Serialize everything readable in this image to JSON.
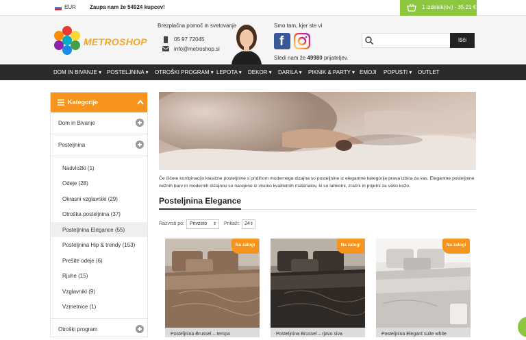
{
  "topbar": {
    "currency": "EUR",
    "promo": "Zaupa nam že 54924 kupcev!",
    "cart": "1 izdelek(ov) - 35.21 €"
  },
  "header": {
    "logo_text": "METROSHOP",
    "help_title": "Brezplačna pomoč in svetovanje",
    "phone": "05 97 72045",
    "email": "info@metroshop.si",
    "social_title": "Smo tam, kjer ste vi",
    "fans_prefix": "Sledi nam že",
    "fans_count": "49980",
    "fans_suffix": "prijateljev.",
    "search_placeholder": "",
    "search_button": "Išči"
  },
  "nav": [
    "DOM IN BIVANJE ▾",
    "POSTELJNINA ▾",
    "OTROŠKI PROGRAM ▾",
    "LEPOTA ▾",
    "DEKOR ▾",
    "DARILA ▾",
    "PIKNIK & PARTY ▾",
    "EMOJI",
    "POPUSTI ▾",
    "OUTLET"
  ],
  "sidebar": {
    "title": "Kategorije",
    "cats": [
      "Dom in Bivanje",
      "Posteljnina",
      "Otroški program"
    ],
    "subs": [
      "Nadvložki (1)",
      "Odeje (28)",
      "Okrasni vzglavniki (29)",
      "Otroška posteljnina (37)",
      "Posteljnina Elegance (55)",
      "Posteljnina Hip & trendy (153)",
      "Prešite odeje (6)",
      "Rjuhe (15)",
      "Vzglavniki (9)",
      "Vzmetnice (1)"
    ]
  },
  "main": {
    "description": "Če iščete kombinacijo klasične posteljnine s pridihom modernega dizajna so posteljnine iz elegantne kategorije prava izbira za vas. Elegantne posteljnine nežnih barv in modernih dizajnov so narejene iz visoko kvalitetnih materialov, ki so lahkotni, zračni in prijetni za vašo kožo.",
    "title": "Posteljnina Elegance",
    "sort_label": "Razvrsti po:",
    "sort_value": "Privzeto",
    "show_label": "Prikaži:",
    "show_value": "24",
    "products": [
      {
        "badge": "Na zalogi",
        "name": "Posteljnina Brussel – tempa"
      },
      {
        "badge": "Na zalogi",
        "name": "Posteljnina Brussel – rjavo siva"
      },
      {
        "badge": "Na zalogi",
        "name": "Posteljnina Elegant suite white"
      }
    ]
  },
  "colors": {
    "accent": "#f7941d",
    "cart": "#8dc63f",
    "nav": "#2b2b2b"
  }
}
